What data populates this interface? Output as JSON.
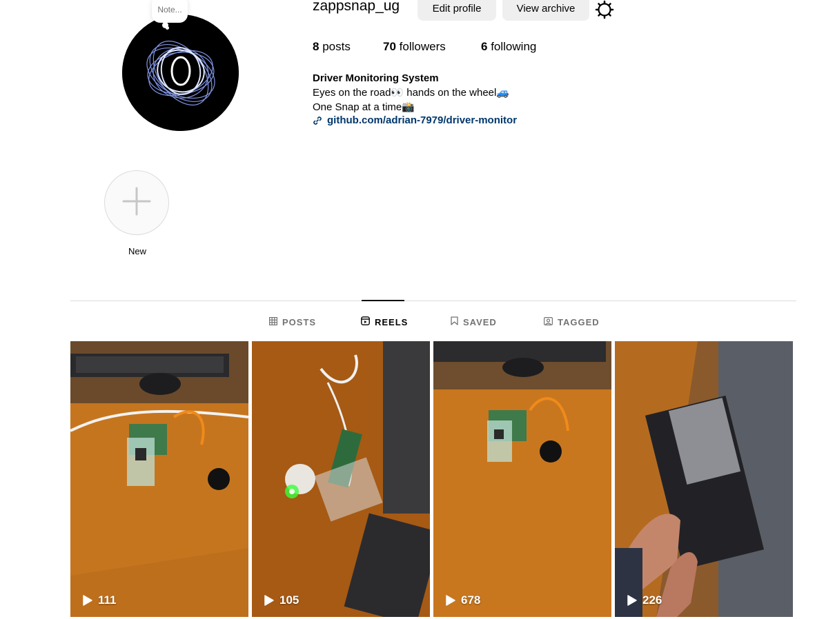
{
  "profile": {
    "username": "zappsnap_ug",
    "note_placeholder": "Note...",
    "edit_profile_label": "Edit profile",
    "view_archive_label": "View archive",
    "settings_icon": "gear-icon"
  },
  "stats": {
    "posts_count": "8",
    "posts_label": "posts",
    "followers_count": "70",
    "followers_label": "followers",
    "following_count": "6",
    "following_label": "following"
  },
  "bio": {
    "name": "Driver Monitoring System",
    "line1": "Eyes on the road👀 hands on the wheel🚙",
    "line2": "One Snap at a time📸",
    "link": "github.com/adrian-7979/driver-monitor"
  },
  "highlights": {
    "new_label": "New"
  },
  "tabs": [
    {
      "label": "POSTS",
      "icon": "grid-icon",
      "active": false
    },
    {
      "label": "REELS",
      "icon": "reels-icon",
      "active": true
    },
    {
      "label": "SAVED",
      "icon": "bookmark-icon",
      "active": false
    },
    {
      "label": "TAGGED",
      "icon": "tagged-icon",
      "active": false
    }
  ],
  "reels": [
    {
      "views": "111"
    },
    {
      "views": "105"
    },
    {
      "views": "678"
    },
    {
      "views": "226"
    }
  ],
  "colors": {
    "button_bg": "#efefef",
    "link": "#00376b",
    "muted": "#737373",
    "divider": "#dbdbdb"
  }
}
